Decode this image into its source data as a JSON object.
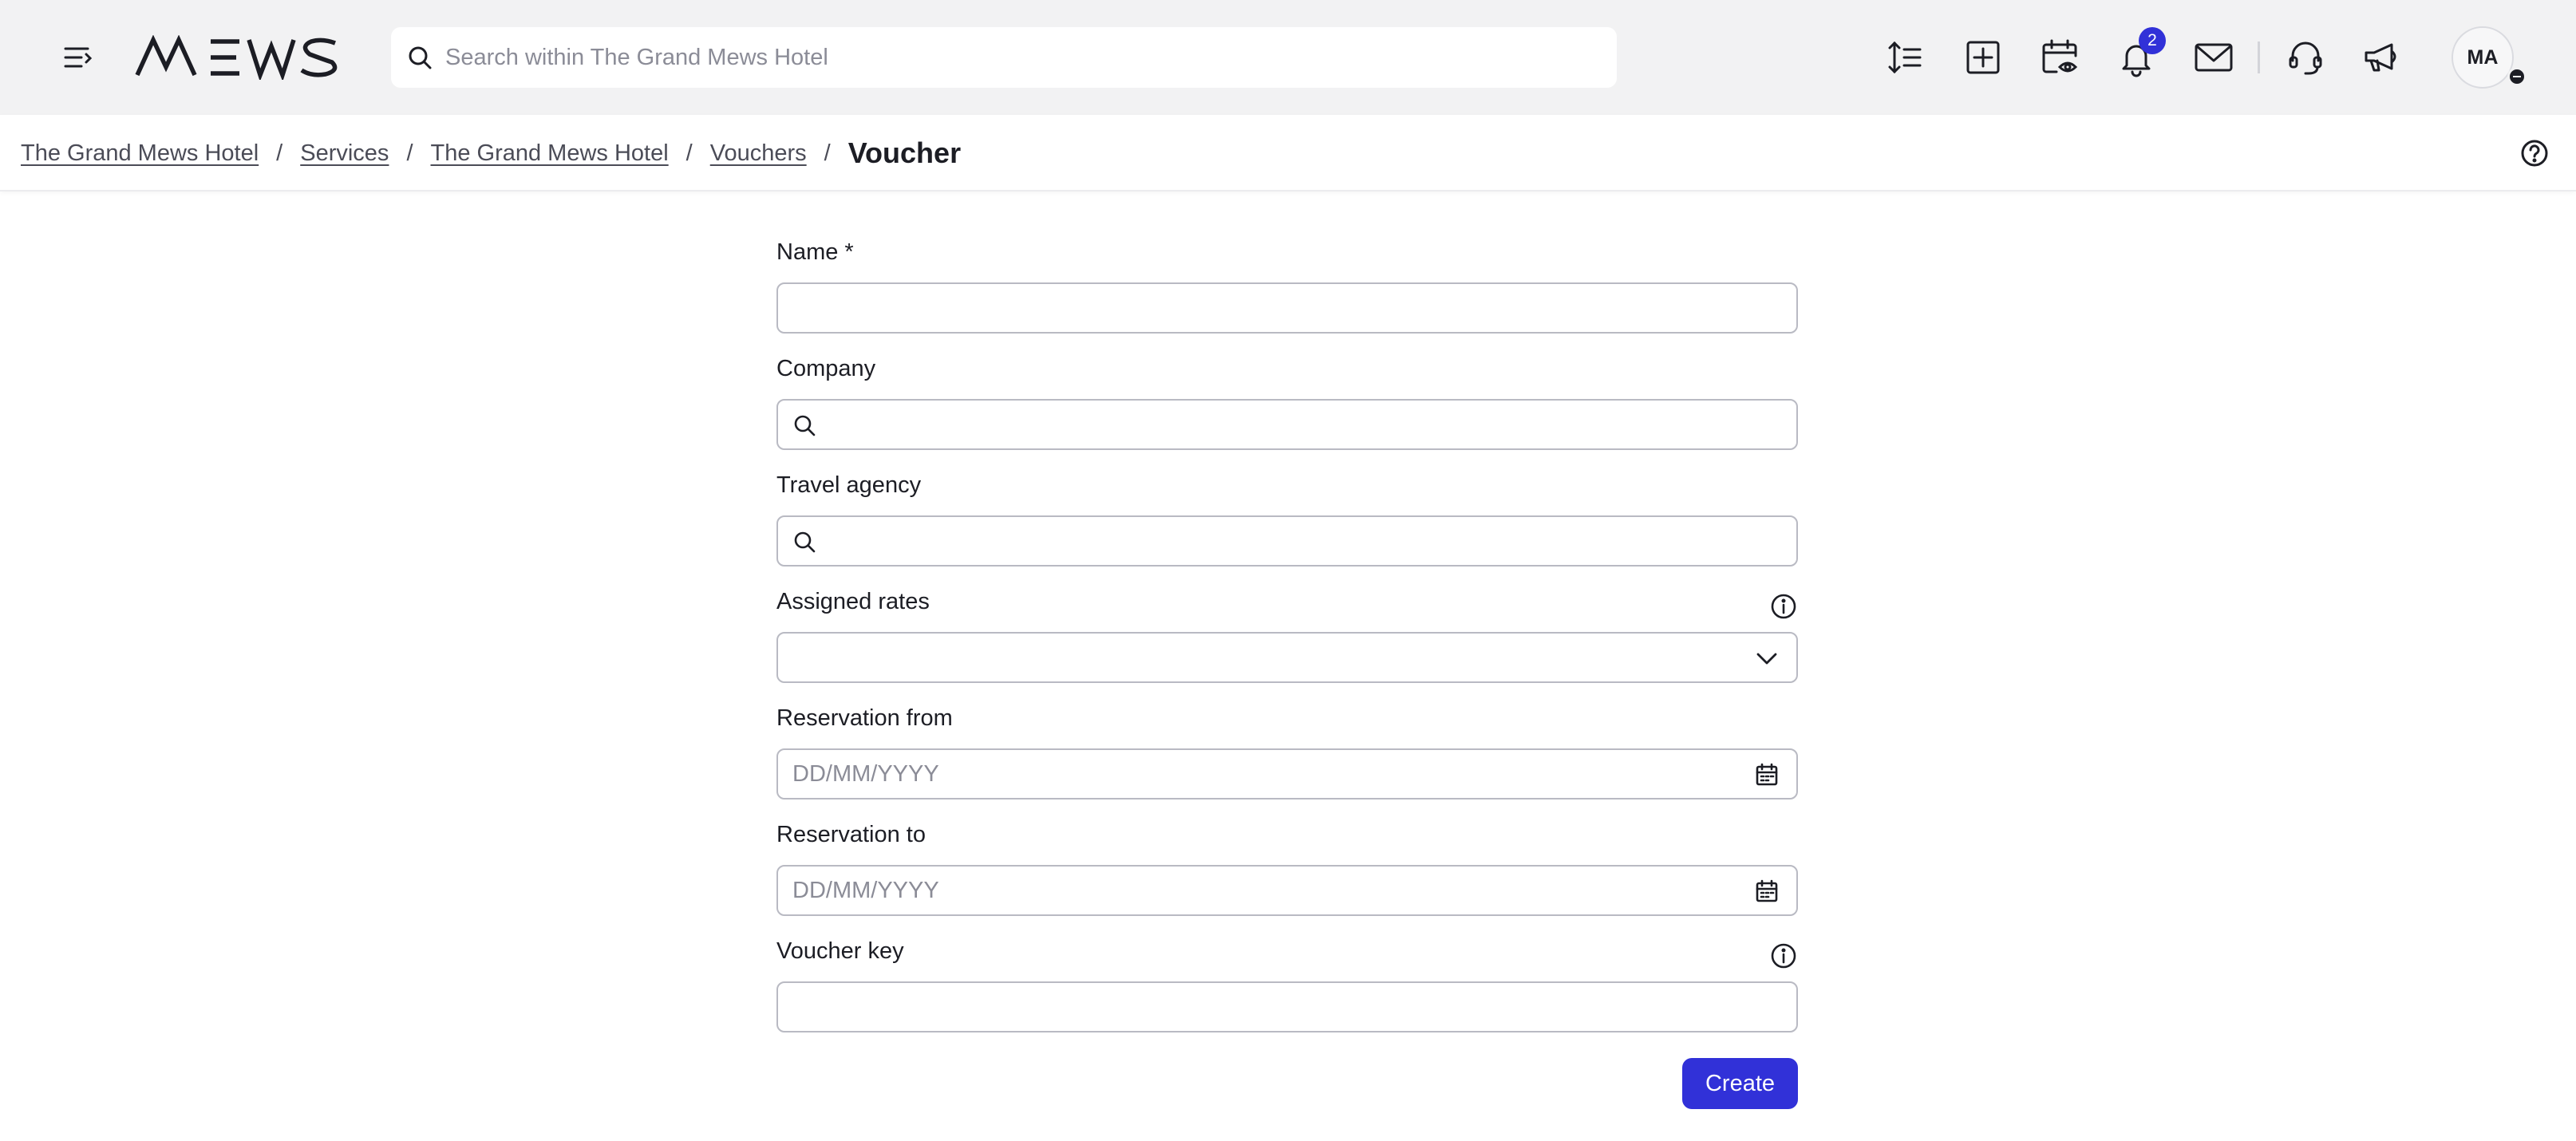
{
  "app": {
    "brand": "MEWS"
  },
  "topbar": {
    "search_placeholder": "Search within The Grand Mews Hotel",
    "notification_count": "2",
    "user_initials": "MA",
    "icons": [
      "menu-icon",
      "search-icon",
      "sort-lines-icon",
      "add-square-icon",
      "calendar-eye-icon",
      "bell-icon",
      "mail-icon",
      "headset-icon",
      "megaphone-icon"
    ]
  },
  "breadcrumb": {
    "items": [
      "The Grand Mews Hotel",
      "Services",
      "The Grand Mews Hotel",
      "Vouchers"
    ],
    "separator": "/",
    "current": "Voucher"
  },
  "form": {
    "name_label": "Name *",
    "company_label": "Company",
    "travel_agency_label": "Travel agency",
    "assigned_rates_label": "Assigned rates",
    "reservation_from_label": "Reservation from",
    "reservation_from_placeholder": "DD/MM/YYYY",
    "reservation_to_label": "Reservation to",
    "reservation_to_placeholder": "DD/MM/YYYY",
    "voucher_key_label": "Voucher key",
    "create_label": "Create"
  },
  "colors": {
    "topbar_bg": "#f2f2f3",
    "accent": "#3131d8",
    "border": "#b9bac3",
    "text": "#1c1d24"
  }
}
